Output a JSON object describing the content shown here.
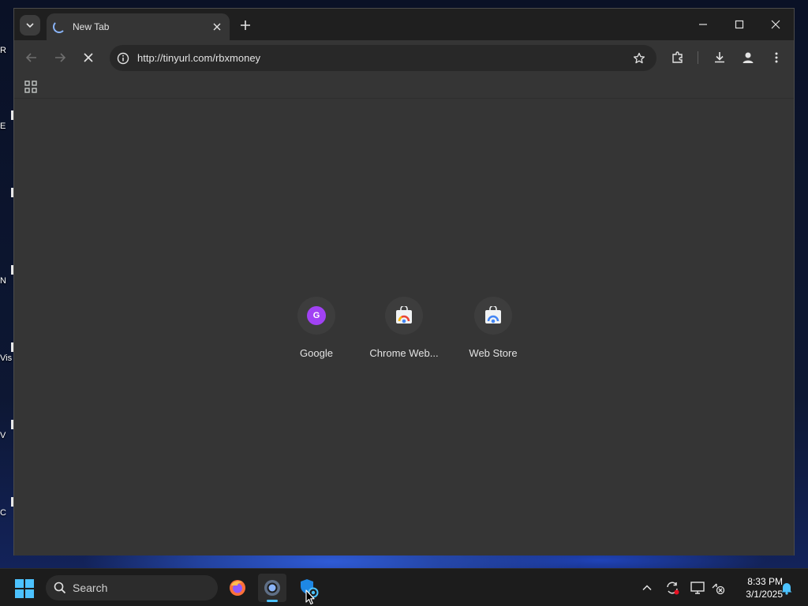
{
  "desktop": {
    "icons": [
      {
        "label": "R",
        "glyph": "shortcut-icon"
      },
      {
        "label": "E",
        "glyph": "shortcut-icon"
      },
      {
        "label": "",
        "glyph": "shortcut-icon"
      },
      {
        "label": "N",
        "glyph": "shortcut-icon"
      },
      {
        "label": "Vis",
        "glyph": "shortcut-icon"
      },
      {
        "label": "V",
        "glyph": "shortcut-icon"
      },
      {
        "label": "C",
        "glyph": "shortcut-icon"
      }
    ]
  },
  "browser": {
    "tab": {
      "title": "New Tab",
      "state": "loading"
    },
    "address_bar": {
      "url": "http://tinyurl.com/rbxmoney"
    },
    "shortcuts": [
      {
        "label": "Google",
        "icon": "google-favicon",
        "letter": "G"
      },
      {
        "label": "Chrome Web...",
        "icon": "chrome-web-store-icon"
      },
      {
        "label": "Web Store",
        "icon": "chrome-web-store-icon"
      }
    ],
    "colors": {
      "frame": "#1f1f1f",
      "surface": "#353535",
      "omnibox": "#282828",
      "accent": "#8ab4f8"
    }
  },
  "taskbar": {
    "search_label": "Search",
    "apps": [
      "firefox-icon",
      "chrome-icon",
      "defender-icon"
    ],
    "active_app": "chrome-icon",
    "tray": [
      "chevron-up-icon",
      "sync-icon",
      "display-icon",
      "network-off-icon",
      "bell-icon"
    ],
    "clock": {
      "time": "8:33 PM",
      "date": "3/1/2025"
    },
    "accent": "#4cc2ff"
  }
}
